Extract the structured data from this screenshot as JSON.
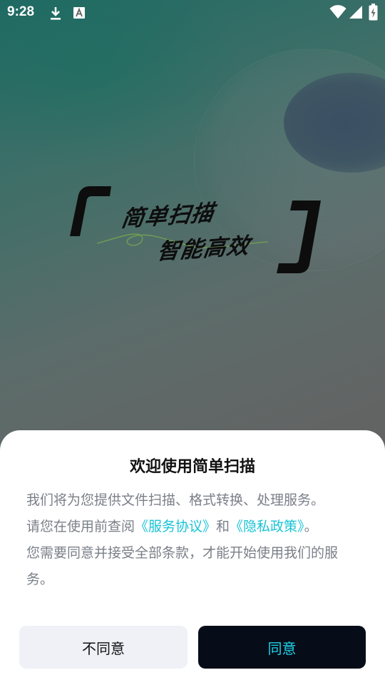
{
  "status_bar": {
    "time": "9:28",
    "left_icons": [
      "download-icon",
      "font-app-icon"
    ],
    "right_icons": [
      "wifi-icon",
      "signal-icon",
      "battery-charging-icon"
    ]
  },
  "hero": {
    "slogan_line1": "简单扫描",
    "slogan_line2": "智能高效"
  },
  "dialog": {
    "title": "欢迎使用简单扫描",
    "body_line1": "我们将为您提供文件扫描、格式转换、处理服务。",
    "body_line2_prefix": "请您在使用前查阅",
    "service_link": "《服务协议》",
    "and_text": "和",
    "privacy_link": "《隐私政策》",
    "body_line2_suffix": "。",
    "body_line3": "您需要同意并接受全部条款，才能开始使用我们的服务。",
    "disagree_label": "不同意",
    "agree_label": "同意"
  },
  "colors": {
    "link": "#19c3d6",
    "agree_button_bg": "#060d18",
    "agree_button_text": "#20d3ea",
    "disagree_button_bg": "#eff1f6"
  }
}
